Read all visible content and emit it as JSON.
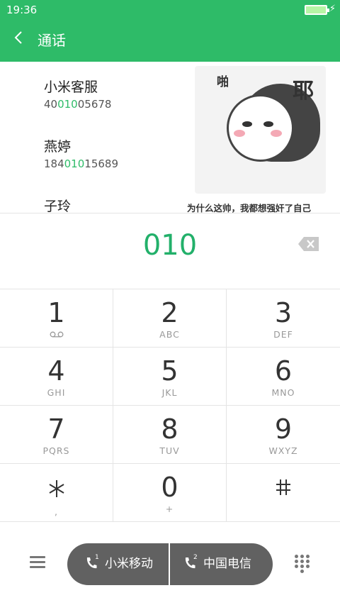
{
  "status": {
    "time": "19:36"
  },
  "header": {
    "title": "通话",
    "back_icon": "back-arrow-icon"
  },
  "contacts": [
    {
      "name": "小米客服",
      "num_pre": "40",
      "num_match": "010",
      "num_post": "05678"
    },
    {
      "name": "燕婷",
      "num_pre": "184",
      "num_match": "010",
      "num_post": "15689"
    },
    {
      "name": "子玲"
    }
  ],
  "sticker": {
    "bam": "啪",
    "ye": "耶",
    "caption": "为什么这帅，我都想强奸了自己"
  },
  "dial": {
    "number": "010"
  },
  "keys": [
    {
      "digit": "1",
      "letters": "ᴼᴼ"
    },
    {
      "digit": "2",
      "letters": "ABC"
    },
    {
      "digit": "3",
      "letters": "DEF"
    },
    {
      "digit": "4",
      "letters": "GHI"
    },
    {
      "digit": "5",
      "letters": "JKL"
    },
    {
      "digit": "6",
      "letters": "MNO"
    },
    {
      "digit": "7",
      "letters": "PQRS"
    },
    {
      "digit": "8",
      "letters": "TUV"
    },
    {
      "digit": "9",
      "letters": "WXYZ"
    },
    {
      "digit": "*",
      "letters": ","
    },
    {
      "digit": "0",
      "letters": "+"
    },
    {
      "digit": "#",
      "letters": ""
    }
  ],
  "call": {
    "sim1_label": "小米移动",
    "sim1_num": "1",
    "sim2_label": "中国电信",
    "sim2_num": "2"
  },
  "colors": {
    "accent": "#2ebb68",
    "pill": "#616161"
  }
}
